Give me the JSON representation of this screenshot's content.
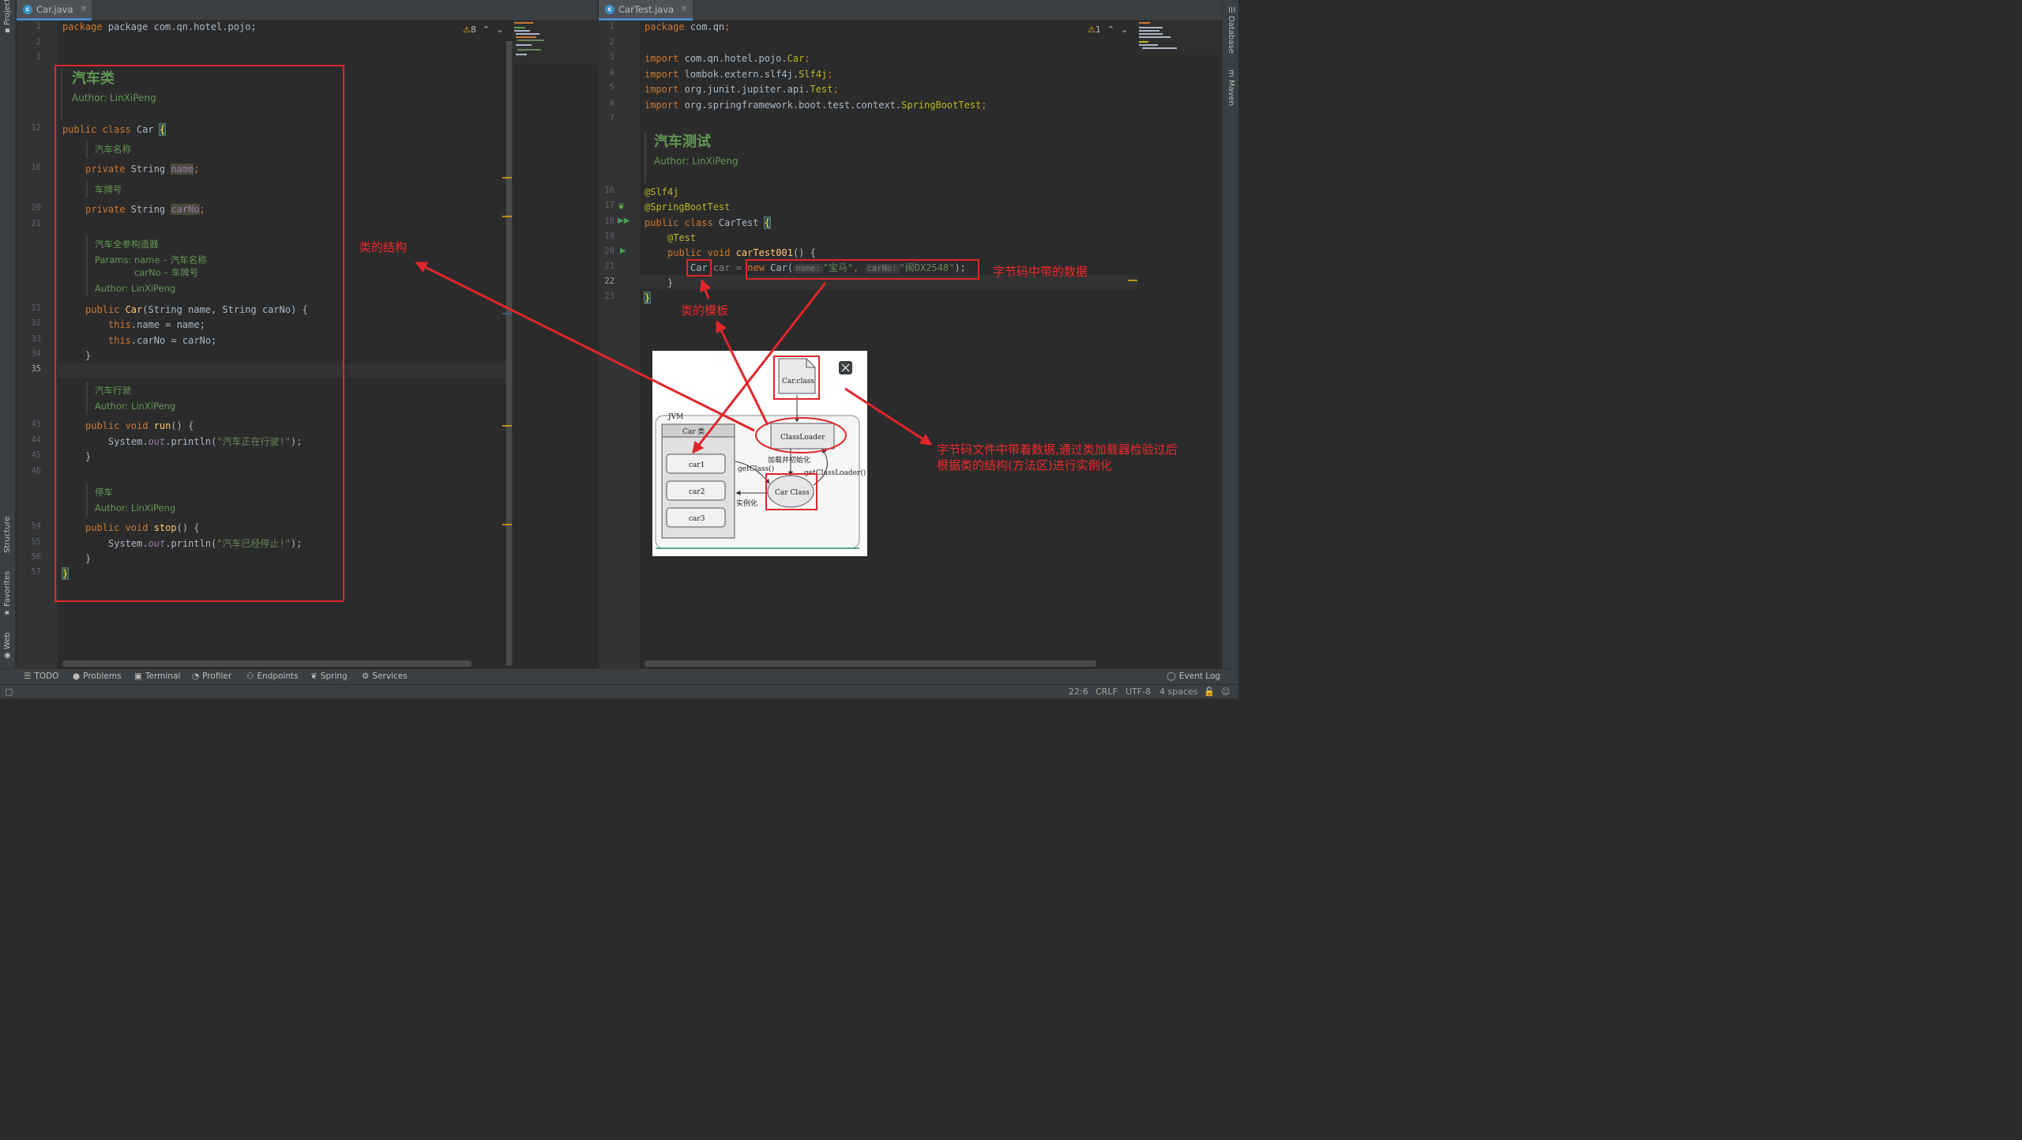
{
  "sidebar_left": {
    "tabs": [
      "Project",
      "Structure",
      "Favorites",
      "Web"
    ]
  },
  "sidebar_right": {
    "tabs": [
      "Database",
      "Maven"
    ]
  },
  "left_pane": {
    "tab": {
      "label": "Car.java"
    },
    "warnings": {
      "count": "8"
    },
    "line_numbers": [
      "1",
      "2",
      "3",
      "12",
      "16",
      "20",
      "21",
      "31",
      "32",
      "33",
      "34",
      "35",
      "43",
      "44",
      "45",
      "46",
      "54",
      "55",
      "56",
      "57"
    ],
    "package_line": "package com.qn.hotel.pojo;",
    "doc_class": {
      "title": "汽车类",
      "author": "Author: LinXiPeng"
    },
    "class_decl": {
      "kw": "public class ",
      "name": "Car ",
      "brace": "{"
    },
    "doc_name": "汽车名称",
    "field_name": {
      "kw": "private ",
      "type": "String ",
      "name": "name",
      "end": ";"
    },
    "doc_carno": "车牌号",
    "field_carno": {
      "kw": "private ",
      "type": "String ",
      "name": "carNo",
      "end": ";"
    },
    "doc_ctor": {
      "title": "汽车全参构造器",
      "params_label": "Params:",
      "p1": "name – 汽车名称",
      "p2": "carNo – 车牌号",
      "author": "Author:  LinXiPeng"
    },
    "ctor_decl": {
      "kw": "public ",
      "name": "Car",
      "sig": "(String name, String carNo) {"
    },
    "ctor_body1": {
      "kw": "this",
      "rest": ".name = name;"
    },
    "ctor_body2": {
      "kw": "this",
      "rest": ".carNo = carNo;"
    },
    "close_brace": "}",
    "doc_run": {
      "title": "汽车行驶",
      "author": "Author: LinXiPeng"
    },
    "run_decl": {
      "kw": "public void ",
      "name": "run",
      "rest": "() {"
    },
    "run_body": {
      "pre": "System.",
      "out": "out",
      "mid": ".println(",
      "str": "\"汽车正在行驶!\"",
      "end": ");"
    },
    "doc_stop": {
      "title": "停车",
      "author": "Author: LinXiPeng"
    },
    "stop_decl": {
      "kw": "public void ",
      "name": "stop",
      "rest": "() {"
    },
    "stop_body": {
      "pre": "System.",
      "out": "out",
      "mid": ".println(",
      "str": "\"汽车已经停止!\"",
      "end": ");"
    },
    "final_brace": "}"
  },
  "right_pane": {
    "tab": {
      "label": "CarTest.java"
    },
    "warnings": {
      "count": "1"
    },
    "line_numbers": [
      "1",
      "2",
      "3",
      "4",
      "5",
      "6",
      "7",
      "16",
      "17",
      "18",
      "19",
      "20",
      "21",
      "22",
      "23"
    ],
    "package_line": {
      "kw": "package ",
      "name": "com.qn",
      "end": ";"
    },
    "imports": [
      {
        "kw": "import ",
        "path": "com.qn.hotel.pojo.",
        "cls": "Car",
        "end": ";"
      },
      {
        "kw": "import ",
        "path": "lombok.extern.slf4j.",
        "cls": "Slf4j",
        "end": ";"
      },
      {
        "kw": "import ",
        "path": "org.junit.jupiter.api.",
        "cls": "Test",
        "end": ";"
      },
      {
        "kw": "import ",
        "path": "org.springframework.boot.test.context.",
        "cls": "SpringBootTest",
        "end": ";"
      }
    ],
    "doc_class": {
      "title": "汽车测试",
      "author": "Author: LinXiPeng"
    },
    "ann1": "@Slf4j",
    "ann2": "@SpringBootTest",
    "class_decl": {
      "kw": "public class ",
      "name": "CarTest ",
      "brace": "{"
    },
    "test_ann": "@Test",
    "method_decl": {
      "kw": "public void ",
      "name": "carTest001",
      "rest": "() {"
    },
    "stmt": {
      "type": "Car",
      "var": " car = ",
      "new": "new ",
      "ctor": "Car(",
      "hint1": "name:",
      "arg1": "\"宝马\"",
      "comma": ", ",
      "hint2": "carNo:",
      "arg2": "\"闽DX2548\"",
      "end": ");"
    },
    "close_method": "}",
    "close_class": "}"
  },
  "annotations": {
    "class_structure": "类的结构",
    "bytecode_data": "字节码中带的数据",
    "class_template": "类的模板",
    "explain_line1": "字节码文件中带着数据,通过类加载器检验过后",
    "explain_line2": "根据类的结构(方法区)进行实例化"
  },
  "diagram": {
    "car_class_file": "Car.class",
    "class_loader": "ClassLoader",
    "jvm": "JVM",
    "car_header": "Car 类",
    "instances": [
      "car1",
      "car2",
      "car3"
    ],
    "car_class": "Car Class",
    "load_init": "加载并初始化",
    "get_class": "getClass()",
    "get_class_loader": "getClassLoader()",
    "instantiate": "实例化"
  },
  "tool_windows": [
    "TODO",
    "Problems",
    "Terminal",
    "Profiler",
    "Endpoints",
    "Spring",
    "Services"
  ],
  "event_log": "Event Log",
  "status": {
    "position": "22:6",
    "line_sep": "CRLF",
    "encoding": "UTF-8",
    "indent": "4 spaces"
  }
}
